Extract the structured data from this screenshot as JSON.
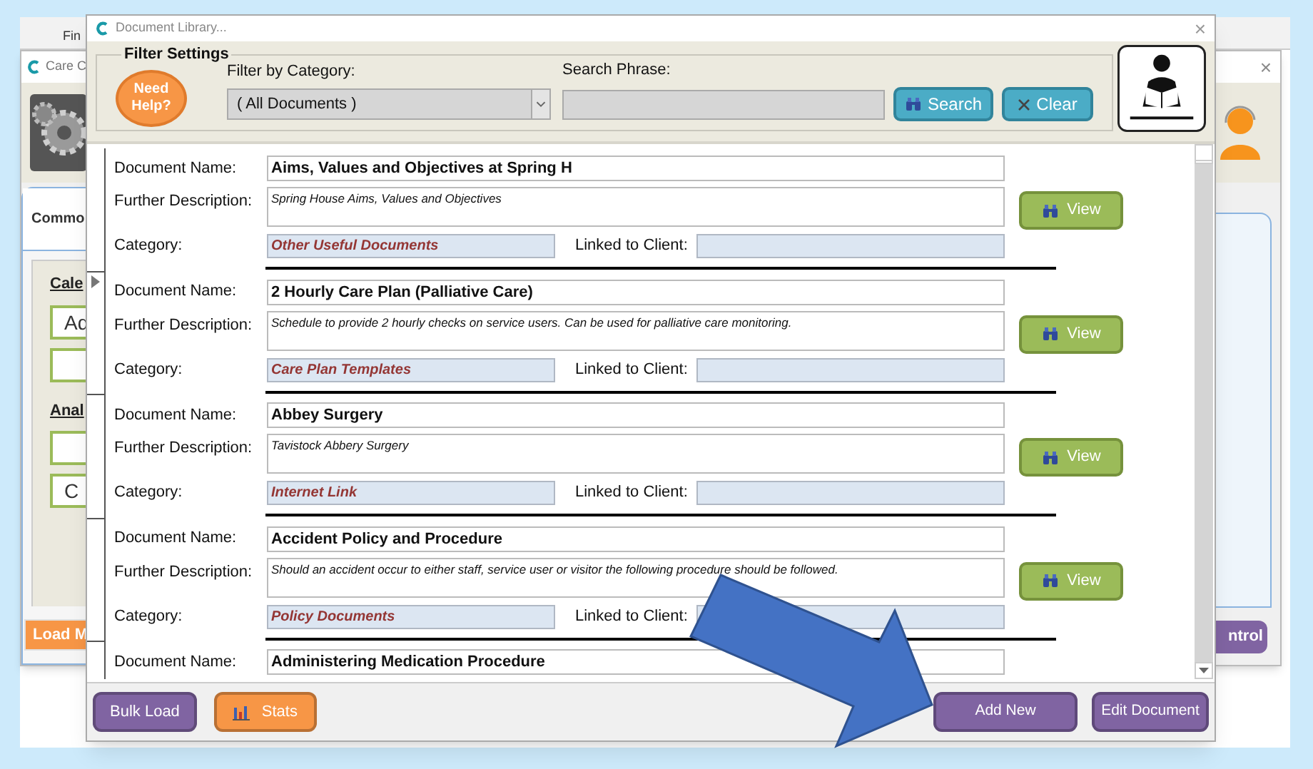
{
  "back_window": {
    "toolbar_item": "Fin",
    "title": "Care C",
    "close_button": "×",
    "tab": "Commo",
    "groups": [
      {
        "heading": "Cale",
        "buttons": [
          {
            "kind": "text",
            "label": "Ad"
          },
          {
            "kind": "empty"
          }
        ]
      },
      {
        "heading": "Anal",
        "buttons": [
          {
            "kind": "empty"
          },
          {
            "kind": "text",
            "label": "C"
          }
        ]
      }
    ],
    "left_button": "Load M",
    "right_button": "ntrol"
  },
  "dialog": {
    "title": "Document Library...",
    "close_button": "×",
    "filter": {
      "legend": "Filter Settings",
      "help_button": "Need Help?",
      "category_label": "Filter by Category:",
      "category_value": "( All Documents )",
      "search_label": "Search Phrase:",
      "search_button": "Search",
      "clear_button": "Clear"
    },
    "records": [
      {
        "current": false,
        "name_label": "Document Name:",
        "name": "Aims, Values and Objectives at Spring H",
        "description_label": "Further Description:",
        "description": "Spring House Aims, Values and Objectives",
        "category_label": "Category:",
        "category": "Other Useful Documents",
        "linked_label": "Linked to Client:",
        "view_button": "View"
      },
      {
        "current": true,
        "name_label": "Document Name:",
        "name": "2 Hourly Care Plan (Palliative Care)",
        "description_label": "Further Description:",
        "description": "Schedule to provide 2 hourly checks on service users.  Can be used for palliative care monitoring.",
        "category_label": "Category:",
        "category": "Care Plan Templates",
        "linked_label": "Linked to Client:",
        "view_button": "View"
      },
      {
        "current": false,
        "name_label": "Document Name:",
        "name": "Abbey Surgery",
        "description_label": "Further Description:",
        "description": "Tavistock Abbery Surgery",
        "category_label": "Category:",
        "category": "Internet Link",
        "linked_label": "Linked to Client:",
        "view_button": "View"
      },
      {
        "current": false,
        "name_label": "Document Name:",
        "name": "Accident Policy and Procedure",
        "description_label": "Further Description:",
        "description": "Should an accident occur to either staff, service user or visitor the following procedure should be followed.",
        "category_label": "Category:",
        "category": "Policy Documents",
        "linked_label": "Linked to Client:",
        "view_button": "View"
      },
      {
        "current": false,
        "name_label": "Document Name:",
        "name": "Administering Medication Procedure"
      }
    ],
    "left_buttons": [
      {
        "kind": "plain",
        "label": "Bulk Load",
        "color": "#8064a2"
      },
      {
        "kind": "stats",
        "label": "Stats",
        "color": "#f79646"
      }
    ],
    "right_buttons": [
      {
        "label": "Add New"
      },
      {
        "label": "Edit Document"
      }
    ]
  }
}
